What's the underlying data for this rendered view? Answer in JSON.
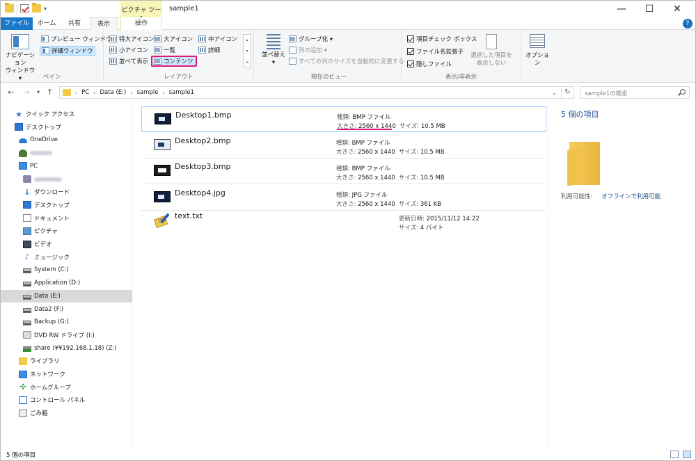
{
  "window": {
    "title": "sample1",
    "context_tab_group": "ピクチャ ツール",
    "controls": {
      "minimize": "—",
      "maximize": "☐",
      "close": "✕"
    }
  },
  "tabs": {
    "file": "ファイル",
    "home": "ホーム",
    "share": "共有",
    "view": "表示",
    "manage": "操作"
  },
  "ribbon": {
    "pane": {
      "label": "ペイン",
      "nav_pane": "ナビゲーション\nウィンドウ ▾",
      "preview": "プレビュー ウィンドウ",
      "details": "詳細ウィンドウ"
    },
    "layout": {
      "label": "レイアウト",
      "xl_icons": "特大アイコン",
      "large_icons": "大アイコン",
      "medium_icons": "中アイコン",
      "small_icons": "小アイコン",
      "list": "一覧",
      "details": "詳細",
      "tiles": "並べて表示",
      "content": "コンテンツ"
    },
    "current_view": {
      "label": "現在のビュー",
      "sort": "並べ替え",
      "group": "グループ化 ▾",
      "add_columns": "列の追加 ▾",
      "fit_columns": "すべての列のサイズを自動的に変更する"
    },
    "show_hide": {
      "label": "表示/非表示",
      "item_checkboxes": "項目チェック ボックス",
      "extensions": "ファイル名拡張子",
      "hidden": "隠しファイル",
      "hide_selected": "選択した項目を\n表示しない"
    },
    "options": {
      "label": "オプション"
    }
  },
  "address": {
    "crumbs": [
      "PC",
      "Data (E:)",
      "sample",
      "sample1"
    ],
    "search_placeholder": "sample1の検索"
  },
  "nav": [
    {
      "label": "クイック アクセス",
      "icon": "star-icon",
      "indent": 1
    },
    {
      "label": "デスクトップ",
      "icon": "desktop-icon",
      "indent": 1
    },
    {
      "label": "OneDrive",
      "icon": "cloud-icon",
      "indent": 2
    },
    {
      "label": "",
      "icon": "user-icon",
      "indent": 2,
      "blurred": true
    },
    {
      "label": "PC",
      "icon": "pc-icon",
      "indent": 2
    },
    {
      "label": "",
      "icon": "network-pc-icon",
      "indent": 3,
      "blurred": true
    },
    {
      "label": "ダウンロード",
      "icon": "download-icon",
      "indent": 3
    },
    {
      "label": "デスクトップ",
      "icon": "desktop-icon",
      "indent": 3
    },
    {
      "label": "ドキュメント",
      "icon": "document-icon",
      "indent": 3
    },
    {
      "label": "ピクチャ",
      "icon": "pictures-icon",
      "indent": 3
    },
    {
      "label": "ビデオ",
      "icon": "video-icon",
      "indent": 3
    },
    {
      "label": "ミュージック",
      "icon": "music-icon",
      "indent": 3
    },
    {
      "label": "System (C:)",
      "icon": "drive-icon",
      "indent": 3
    },
    {
      "label": "Application (D:)",
      "icon": "drive-icon",
      "indent": 3
    },
    {
      "label": "Data (E:)",
      "icon": "drive-icon",
      "indent": 3,
      "selected": true
    },
    {
      "label": "Data2 (F:)",
      "icon": "drive-icon",
      "indent": 3
    },
    {
      "label": "Backup (G:)",
      "icon": "drive-icon",
      "indent": 3
    },
    {
      "label": "DVD RW ドライブ (I:)",
      "icon": "dvd-icon",
      "indent": 3
    },
    {
      "label": "share (¥¥192.168.1.18) (Z:)",
      "icon": "network-drive-icon",
      "indent": 3
    },
    {
      "label": "ライブラリ",
      "icon": "library-icon",
      "indent": 2
    },
    {
      "label": "ネットワーク",
      "icon": "network-icon",
      "indent": 2
    },
    {
      "label": "ホームグループ",
      "icon": "homegroup-icon",
      "indent": 2
    },
    {
      "label": "コントロール パネル",
      "icon": "control-panel-icon",
      "indent": 2
    },
    {
      "label": "ごみ箱",
      "icon": "recycle-bin-icon",
      "indent": 2
    }
  ],
  "files": [
    {
      "name": "Desktop1.bmp",
      "type_label": "種類:",
      "type": "BMP ファイル",
      "dim_label": "大きさ:",
      "dims": "2560 x 1440",
      "size_label": "サイズ:",
      "size": "10.5 MB",
      "thumb": "t1",
      "selected": true
    },
    {
      "name": "Desktop2.bmp",
      "type_label": "種類:",
      "type": "BMP ファイル",
      "dim_label": "大きさ:",
      "dims": "2560 x 1440",
      "size_label": "サイズ:",
      "size": "10.5 MB",
      "thumb": "t2"
    },
    {
      "name": "Desktop3.bmp",
      "type_label": "種類:",
      "type": "BMP ファイル",
      "dim_label": "大きさ:",
      "dims": "2560 x 1440",
      "size_label": "サイズ:",
      "size": "10.5 MB",
      "thumb": "t3"
    },
    {
      "name": "Desktop4.jpg",
      "type_label": "種類:",
      "type": "JPG ファイル",
      "dim_label": "大きさ:",
      "dims": "2560 x 1440",
      "size_label": "サイズ:",
      "size": "361 KB",
      "thumb": "t1"
    }
  ],
  "textfile": {
    "name": "text.txt",
    "date_label": "更新日時:",
    "date": "2015/11/12 14:22",
    "size_label": "サイズ:",
    "size": "4 バイト"
  },
  "details_pane": {
    "count": "5 個の項目",
    "avail_label": "利用可能性:",
    "avail": "オフラインで利用可能"
  },
  "status": {
    "count": "5 個の項目"
  },
  "colors": {
    "accent": "#1979ca",
    "highlight": "#e0187a",
    "context_tab": "#f9f5b8"
  }
}
